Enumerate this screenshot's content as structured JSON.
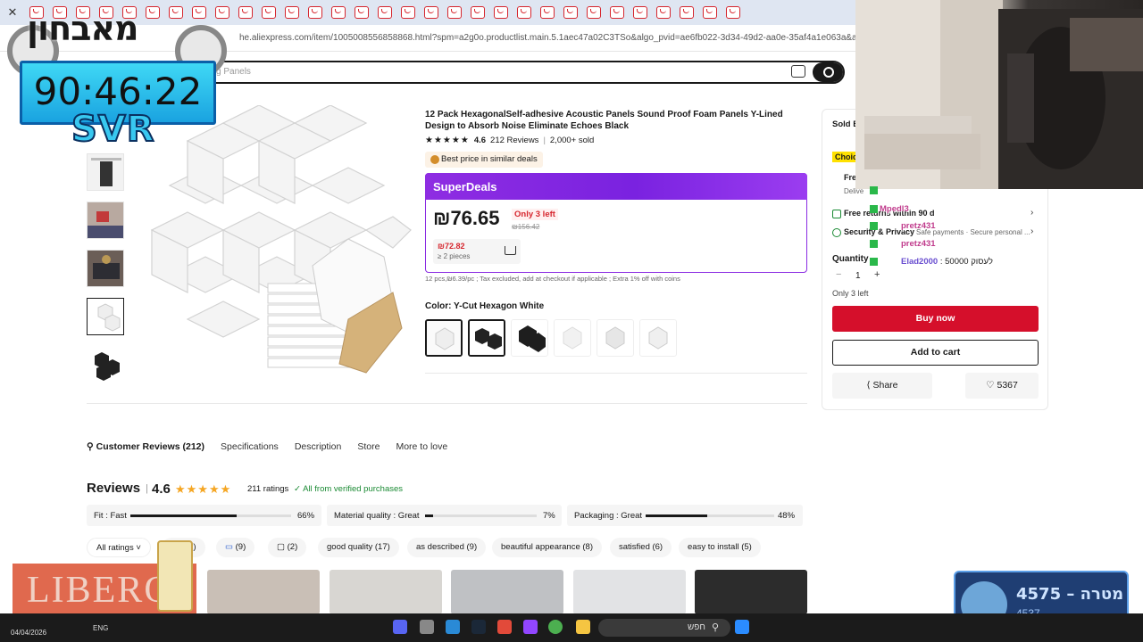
{
  "browser": {
    "url": "he.aliexpress.com/item/1005008556858868.html?spm=a2g0o.productlist.main.5.1aec47a02C3TSo&algo_pvid=ae6fb022-3d34-49d2-aa0e-35af4a1e063a&algo_exp_id=a",
    "search_placeholder": "g Panels"
  },
  "overlay": {
    "logo_text": "מאבחון",
    "timer": "90:46:22",
    "timer_tag": "SVR",
    "ad_text": "LIBERO",
    "score_main": "4575 – מטרה",
    "score_sub": "4537"
  },
  "product": {
    "title": "12 Pack HexagonalSelf-adhesive Acoustic Panels Sound Proof Foam Panels Y-Lined Design to Absorb Noise Eliminate Echoes Black",
    "rating": "4.6",
    "reviews": "212 Reviews",
    "sold": "2,000+ sold",
    "best_price": "Best price in similar deals",
    "superdeals": "SuperDeals",
    "price": "₪76.65",
    "only_left": "Only 3 left",
    "old_price": "₪156.42",
    "bulk_price": "₪72.82",
    "bulk_qty": "≥ 2 pieces",
    "tax_note": "12 pcs,₪6.39/pc ; Tax excluded, add at checkout if applicable ; Extra 1% off with coins",
    "color_label": "Color: Y-Cut Hexagon White"
  },
  "sidebar": {
    "sold_by": "Sold B",
    "choice": "Choic",
    "free_ship": "Fre",
    "delivery": "Delive",
    "free_returns": "Free returns within 90 d",
    "security": "Security & Privacy",
    "security_sub": "Safe payments · Secure personal ...",
    "quantity_label": "Quantity",
    "quantity": "1",
    "only_left": "Only 3 left",
    "buy_now": "Buy now",
    "add_to_cart": "Add to cart",
    "share": "Share",
    "likes": "5367"
  },
  "chat": [
    {
      "user": "Mpedl3",
      "msg": ""
    },
    {
      "user": "pretz431",
      "msg": ""
    },
    {
      "user": "pretz431",
      "msg": ""
    },
    {
      "user": "Elad2000",
      "msg": ": 50000 לעסוק"
    }
  ],
  "tabs": [
    "Customer Reviews (212)",
    "Specifications",
    "Description",
    "Store",
    "More to love"
  ],
  "reviews": {
    "heading": "Reviews",
    "score": "4.6",
    "count": "211 ratings",
    "verified": "All from verified purchases",
    "bars": [
      {
        "label": "Fit : Fast",
        "pct": "66%",
        "value": 66
      },
      {
        "label": "Material quality : Great",
        "pct": "7%",
        "value": 7
      },
      {
        "label": "Packaging : Great",
        "pct": "48%",
        "value": 48
      }
    ],
    "chips": [
      "All ratings ˅",
      "(25)",
      "(9)",
      "(2)",
      "good quality (17)",
      "as described (9)",
      "beautiful appearance (8)",
      "satisfied (6)",
      "easy to install (5)"
    ]
  },
  "taskbar": {
    "date": "04/04/2026",
    "lang": "ENG",
    "search": "חפש"
  }
}
